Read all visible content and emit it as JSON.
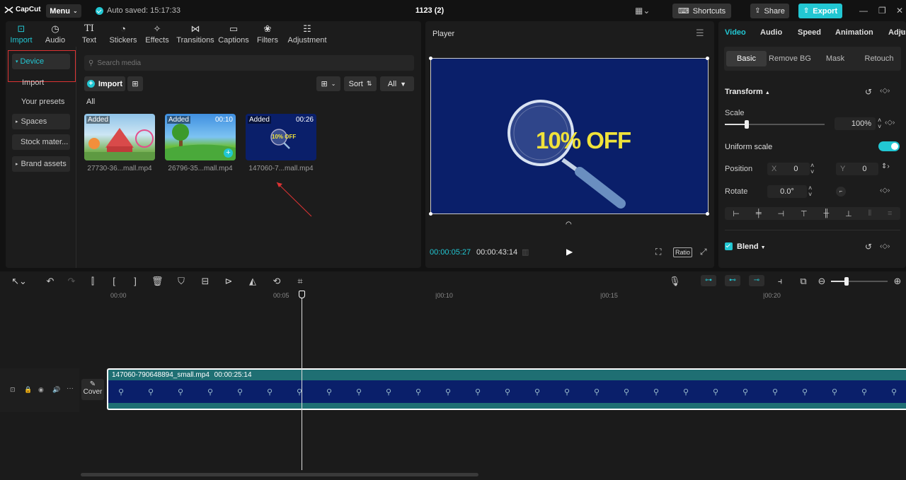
{
  "app": {
    "logo": "CapCut",
    "menu_label": "Menu",
    "autosave": "Auto saved: 15:17:33",
    "project_title": "1123 (2)",
    "shortcuts_label": "Shortcuts",
    "share_label": "Share",
    "export_label": "Export"
  },
  "left_tabs": [
    {
      "label": "Import",
      "icon": "import-icon",
      "active": true
    },
    {
      "label": "Audio",
      "icon": "audio-icon"
    },
    {
      "label": "Text",
      "icon": "text-icon"
    },
    {
      "label": "Stickers",
      "icon": "stickers-icon"
    },
    {
      "label": "Effects",
      "icon": "effects-icon"
    },
    {
      "label": "Transitions",
      "icon": "transitions-icon"
    },
    {
      "label": "Captions",
      "icon": "captions-icon"
    },
    {
      "label": "Filters",
      "icon": "filters-icon"
    },
    {
      "label": "Adjustment",
      "icon": "adjustment-icon"
    }
  ],
  "sidebar": {
    "items": [
      {
        "label": "Device",
        "active": true
      },
      {
        "label": "Import"
      },
      {
        "label": "Your presets"
      },
      {
        "label": "Spaces"
      },
      {
        "label": "Stock mater..."
      },
      {
        "label": "Brand assets"
      }
    ]
  },
  "media": {
    "search_placeholder": "Search media",
    "import_label": "Import",
    "sort_label": "Sort",
    "filter_label": "All",
    "section_label": "All",
    "items": [
      {
        "badge": "Added",
        "duration": "",
        "filename": "27730-36...mall.mp4"
      },
      {
        "badge": "Added",
        "duration": "00:10",
        "filename": "26796-35...mall.mp4"
      },
      {
        "badge": "Added",
        "duration": "00:26",
        "filename": "147060-7...mall.mp4",
        "thumb_text": "10% OFF"
      }
    ]
  },
  "player": {
    "title": "Player",
    "preview_text": "10% OFF",
    "current_time": "00:00:05:27",
    "total_time": "00:00:43:14",
    "ratio_label": "Ratio"
  },
  "properties": {
    "tabs": [
      "Video",
      "Audio",
      "Speed",
      "Animation",
      "Adju"
    ],
    "subtabs": [
      "Basic",
      "Remove BG",
      "Mask",
      "Retouch"
    ],
    "transform_label": "Transform",
    "scale_label": "Scale",
    "scale_value": "100%",
    "scale_fraction": 0.22,
    "uniform_scale_label": "Uniform scale",
    "position_label": "Position",
    "pos_x_label": "X",
    "pos_x_value": "0",
    "pos_y_label": "Y",
    "pos_y_value": "0",
    "rotate_label": "Rotate",
    "rotate_value": "0.0°",
    "blend_label": "Blend"
  },
  "timeline": {
    "ruler": [
      "00:00",
      "00:05",
      "|00:10",
      "|00:15",
      "|00:20"
    ],
    "clip_name": "147060-790648894_small.mp4",
    "clip_duration": "00:00:25:14",
    "cover_label": "Cover"
  },
  "colors": {
    "accent": "#22c7d3",
    "clip": "#1f6f73",
    "preview_bg": "#0a1f6a",
    "offer_text": "#f0e23a"
  }
}
